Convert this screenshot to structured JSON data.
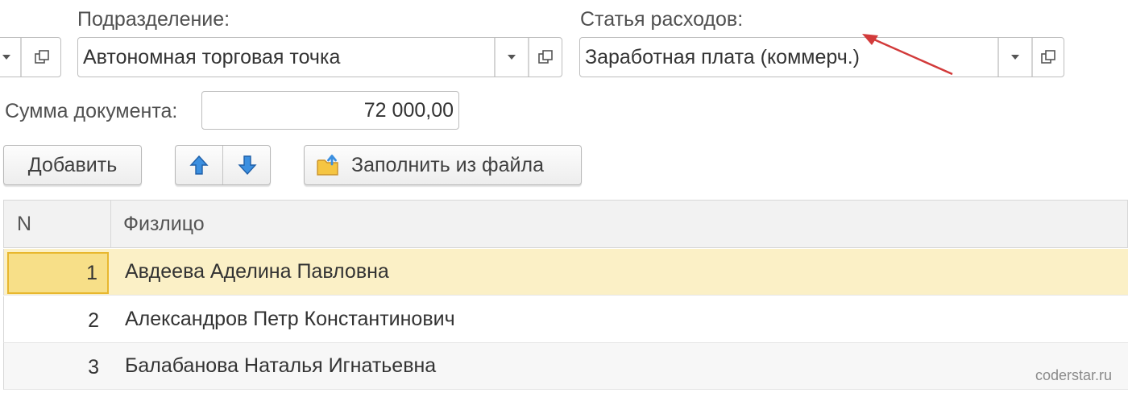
{
  "form": {
    "subdivision_label": "Подразделение:",
    "subdivision_value": "Автономная торговая точка",
    "expense_label": "Статья расходов:",
    "expense_value": "Заработная плата (коммерч.)",
    "sum_label": "Сумма документа:",
    "sum_value": "72 000,00"
  },
  "toolbar": {
    "add_label": "Добавить",
    "fill_from_file_label": "Заполнить из файла"
  },
  "table": {
    "columns": [
      "N",
      "Физлицо"
    ],
    "rows": [
      {
        "n": "1",
        "name": "Авдеева Аделина Павловна"
      },
      {
        "n": "2",
        "name": "Александров Петр Константинович"
      },
      {
        "n": "3",
        "name": "Балабанова Наталья Игнатьевна"
      }
    ]
  },
  "icons": {
    "open": "open-form-icon",
    "dropdown": "dropdown-arrow-icon",
    "up": "arrow-up-icon",
    "down": "arrow-down-icon",
    "folder": "folder-upload-icon"
  },
  "colors": {
    "selected_row": "#fbf0c6",
    "selected_cell": "#f7df88",
    "annotation_arrow": "#d23a3a",
    "arrow_icon": "#3b8fe0"
  },
  "watermark": "coderstar.ru"
}
